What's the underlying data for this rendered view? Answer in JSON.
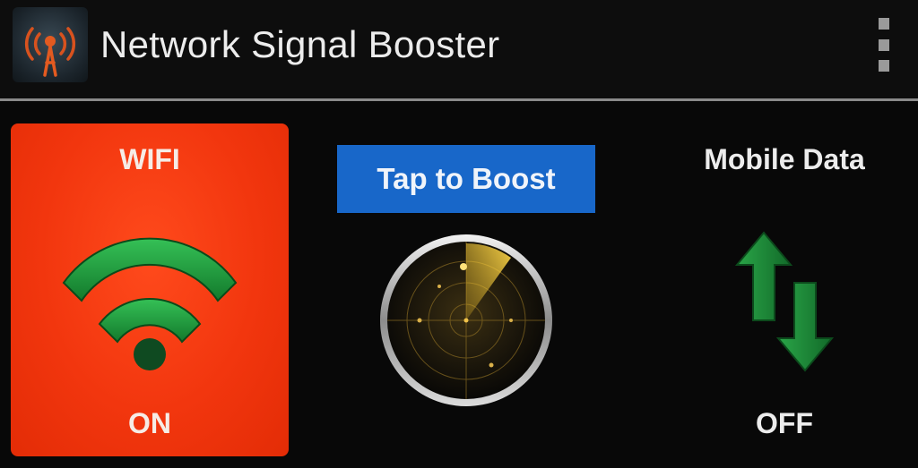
{
  "header": {
    "title": "Network Signal Booster",
    "app_icon": "antenna-icon",
    "menu_icon": "overflow-menu-icon"
  },
  "wifi": {
    "label": "WIFI",
    "state": "ON",
    "icon": "wifi-icon",
    "tile_color": "#f2360e",
    "icon_color": "#1f9a3c"
  },
  "boost": {
    "label": "Tap to Boost",
    "button_color": "#1867c9",
    "icon": "radar-icon"
  },
  "mobile_data": {
    "label": "Mobile Data",
    "state": "OFF",
    "icon": "data-transfer-arrows-icon",
    "icon_color": "#1f8a35"
  }
}
